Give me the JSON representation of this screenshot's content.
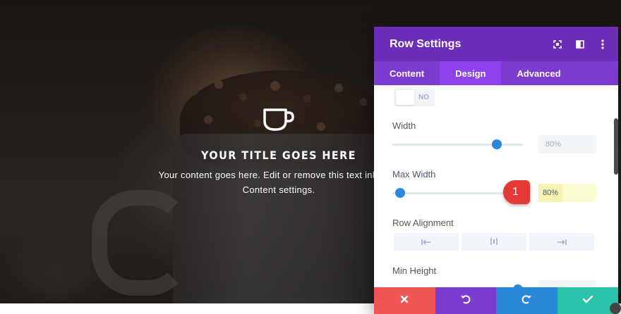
{
  "hero": {
    "icon": "coffee-cup-icon",
    "title": "YOUR TITLE GOES HERE",
    "text_line1": "Your content goes here. Edit or remove this text inline or",
    "text_line2": "Content settings."
  },
  "panel": {
    "title": "Row Settings",
    "header_icons": [
      "fullscreen-icon",
      "columns-icon",
      "more-icon"
    ],
    "tabs": [
      {
        "label": "Content",
        "active": false
      },
      {
        "label": "Design",
        "active": true
      },
      {
        "label": "Advanced",
        "active": false
      }
    ],
    "toggle": {
      "label": "NO",
      "value": false
    },
    "width": {
      "label": "Width",
      "value": "80%",
      "slider_fraction": 0.8
    },
    "max_width": {
      "label": "Max Width",
      "value": "80%",
      "slider_fraction": 0.06
    },
    "row_alignment": {
      "label": "Row Alignment",
      "options": [
        "align-left-icon",
        "align-center-icon",
        "align-right-icon"
      ]
    },
    "min_height": {
      "label": "Min Height"
    },
    "footer": [
      "close-icon",
      "undo-icon",
      "redo-icon",
      "check-icon"
    ]
  },
  "annotation": {
    "badge": "1"
  },
  "colors": {
    "header": "#6c2eb9",
    "tabs": "#7e3bd0",
    "active_tab": "#8f42ec",
    "slider": "#2b87da",
    "badge": "#e53935",
    "close": "#ef5555",
    "undo": "#7d3bcf",
    "redo": "#2b87da",
    "save": "#29c4a9"
  }
}
